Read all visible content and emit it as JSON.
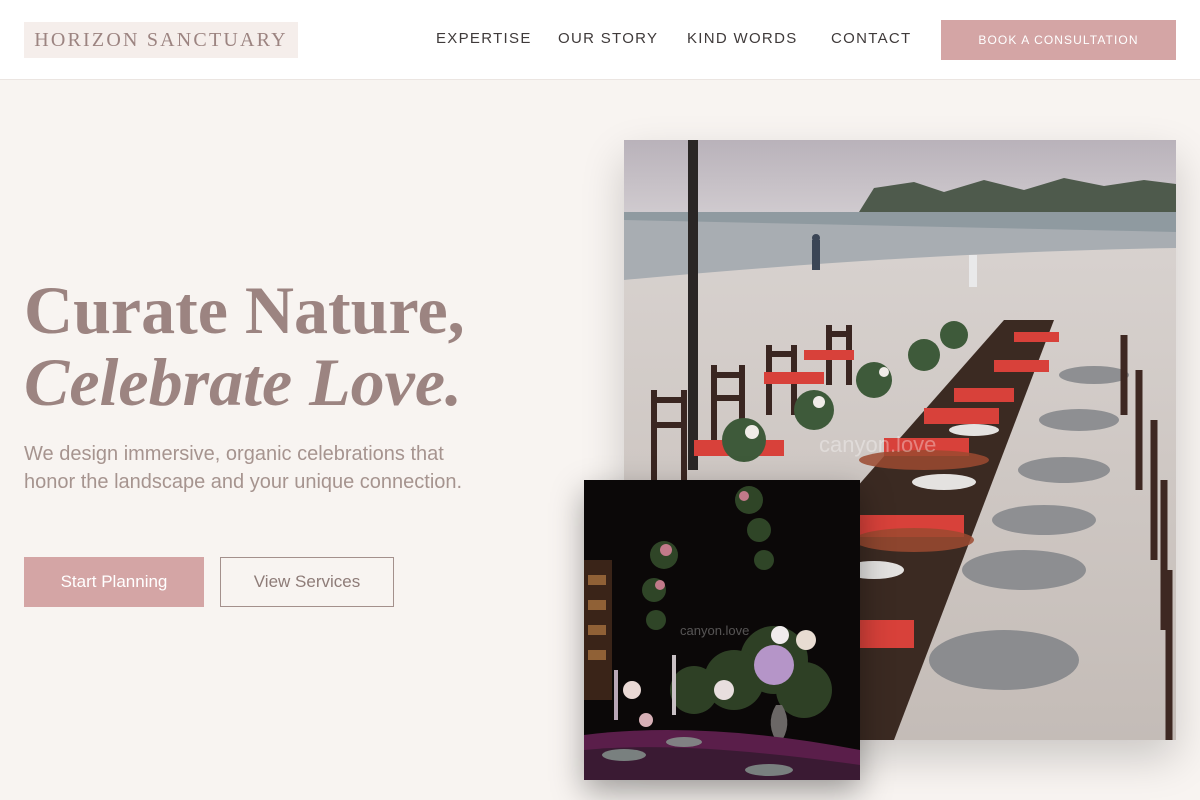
{
  "header": {
    "logo_text": "HORIZON SANCTUARY",
    "nav": [
      "EXPERTISE",
      "OUR STORY",
      "KIND WORDS",
      "CONTACT"
    ],
    "cta_label": "BOOK A CONSULTATION"
  },
  "hero": {
    "headline_line1": "Curate Nature,",
    "headline_line2": "Celebrate Love.",
    "subtext": "We design immersive, organic celebrations that honor the landscape and your unique connection.",
    "primary_button": "Start Planning",
    "secondary_button": "View Services"
  },
  "images": {
    "main_watermark": "canyon.love",
    "small_watermark": "canyon.love"
  },
  "colors": {
    "accent": "#d4a5a5",
    "heading": "#9c8481",
    "background": "#f8f4f1"
  }
}
